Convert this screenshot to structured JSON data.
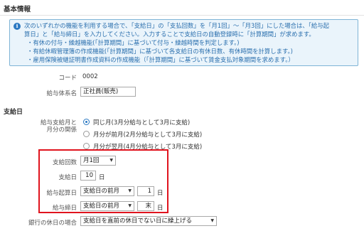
{
  "section_title": "基本情報",
  "info": {
    "icon": "info-icon",
    "lines": [
      "次のいずれかの機能を利用する場合で、「支給日」の「支払回数」を「月1回」～「月3回」にした場合は、「給与起",
      "算日」と「給与締日」を入力してください。入力することで支給日の自動登録時に「計算期間」が求めます。",
      "・有休の付与・繰越機能(「計算期間」に基づいて付与・繰越時間を判定します。)",
      "・有給休暇管理簿の作成機能(「計算期間」に基づいて各支給日の有休日数、有休時間を計算します。)",
      "・雇用保険被継証明書作成資料の作成機能（「計算期間」に基づいて賃金支払対象期間を求めます。）"
    ]
  },
  "code": {
    "label": "コード",
    "value": "0002"
  },
  "salary_system": {
    "label": "給与体系名",
    "value": "正社員(販売)"
  },
  "payday_section": "支給日",
  "relation": {
    "label_line1": "給与支給月と",
    "label_line2": "月分の関係",
    "options": [
      {
        "label": "同じ月(3月分給与として3月に支給)",
        "selected": true
      },
      {
        "label": "月分が前月(2月分給与として3月に支給)",
        "selected": false
      },
      {
        "label": "月分が翌月(4月分給与として3月に支給)",
        "selected": false
      }
    ]
  },
  "pay_count": {
    "label": "支給回数",
    "value": "月1回"
  },
  "payday": {
    "label": "支給日",
    "value": "10",
    "unit": "日"
  },
  "start_day": {
    "label": "給与起算日",
    "base": "支給日の前月",
    "value": "1",
    "unit": "日"
  },
  "closing_day": {
    "label": "給与締日",
    "base": "支給日の前月",
    "value": "末",
    "unit": "日"
  },
  "bank_holiday": {
    "label": "銀行の休日の場合",
    "value": "支給日を直前の休日でない日に繰上げる"
  },
  "colors": {
    "accent": "#2a78c2",
    "highlight_border": "#e0141e",
    "info_bg": "#eaf4fb"
  }
}
